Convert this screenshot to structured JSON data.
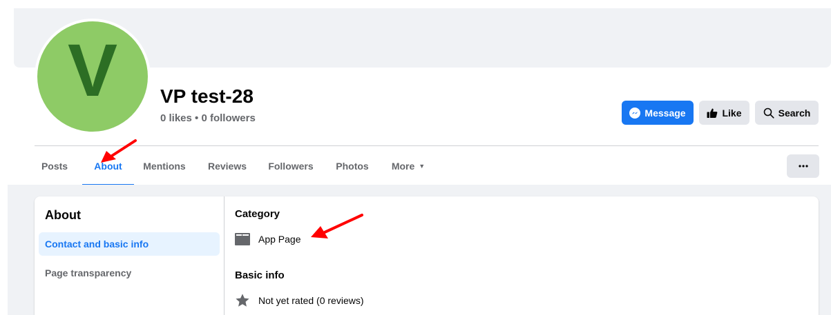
{
  "profile": {
    "avatar_letter": "V",
    "name": "VP test-28",
    "stats": "0 likes • 0 followers"
  },
  "actions": {
    "message_label": "Message",
    "like_label": "Like",
    "search_label": "Search"
  },
  "tabs": [
    {
      "label": "Posts",
      "active": false
    },
    {
      "label": "About",
      "active": true
    },
    {
      "label": "Mentions",
      "active": false
    },
    {
      "label": "Reviews",
      "active": false
    },
    {
      "label": "Followers",
      "active": false
    },
    {
      "label": "Photos",
      "active": false
    },
    {
      "label": "More",
      "active": false
    }
  ],
  "about": {
    "title": "About",
    "sidebar_items": [
      {
        "label": "Contact and basic info",
        "active": true
      },
      {
        "label": "Page transparency",
        "active": false
      }
    ],
    "category_heading": "Category",
    "category_value": "App Page",
    "basic_info_heading": "Basic info",
    "rating_text": "Not yet rated (0 reviews)"
  },
  "colors": {
    "accent": "#1877f2",
    "avatar_bg": "#8ecb66",
    "avatar_letter": "#2c6e24",
    "annotation_arrow": "#ff0000"
  },
  "icons": {
    "message": "messenger-icon",
    "like": "thumbs-up-icon",
    "search": "search-icon",
    "more_tab": "caret-down-icon",
    "more_button": "ellipsis-icon",
    "category": "folder-icon",
    "rating": "star-icon"
  }
}
